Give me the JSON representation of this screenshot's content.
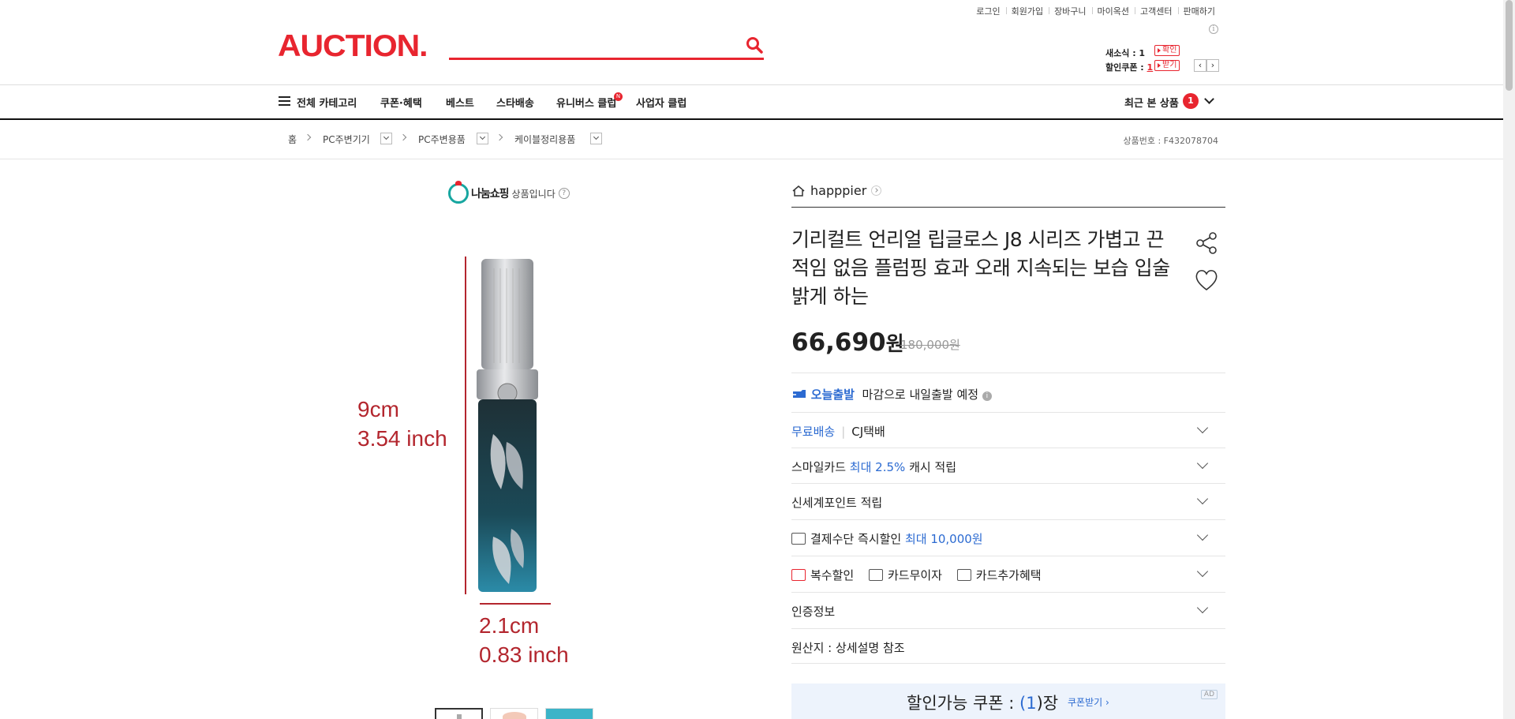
{
  "util_links": [
    "로그인",
    "회원가입",
    "장바구니",
    "마이옥션",
    "고객센터",
    "판매하기"
  ],
  "header": {
    "logo": "AUCTION.",
    "search_placeholder": "",
    "mini": {
      "newsletter_label": "새소식 : 1",
      "newsletter_btn": "확인",
      "coupon_label": "할인쿠폰 : ",
      "coupon_count": "1",
      "coupon_btn": "받기"
    }
  },
  "nav": {
    "all_categories": "전체 카테고리",
    "items": [
      "쿠폰·혜택",
      "베스트",
      "스타배송",
      "유니버스 클럽",
      "사업자 클럽"
    ],
    "new_badge": "N",
    "recent_label": "최근 본 상품",
    "recent_count": "1"
  },
  "breadcrumb": {
    "home": "홈",
    "levels": [
      "PC주변기기",
      "PC주변용품",
      "케이블정리용품"
    ],
    "product_no": "상품번호 : F432078704"
  },
  "share": {
    "brand": "나눔쇼핑",
    "text": "상품입니다",
    "help": "?"
  },
  "image": {
    "height_cm": "9cm",
    "height_inch": "3.54 inch",
    "width_cm": "2.1cm",
    "width_inch": "0.83 inch"
  },
  "product": {
    "seller": "happpier",
    "title": "기리컬트 언리얼 립글로스 J8 시리즈 가볍고 끈적임 없음 플럼핑 효과 오래 지속되는 보습 입술 밝게 하는",
    "price": "66,690",
    "price_unit": "원",
    "original_price": "180,000원"
  },
  "rows": {
    "today_ship": "오늘출발",
    "today_ship_desc": "마감으로 내일출발 예정",
    "free_ship": "무료배송",
    "courier": "CJ택배",
    "smile_card": "스마일카드",
    "smile_max": "최대 2.5%",
    "smile_tail": "캐시 적립",
    "shinsegae": "신세계포인트 적립",
    "pay_discount": "결제수단 즉시할인",
    "pay_max": "최대 10,000원",
    "multi_discount": "복수할인",
    "card_free": "카드무이자",
    "card_extra": "카드추가혜택",
    "cert": "인증정보",
    "origin": "원산지 : 상세설명 참조"
  },
  "coupon": {
    "label": "할인가능 쿠폰 : ",
    "open": "(",
    "count": "1",
    "close": ")장",
    "link": "쿠폰받기",
    "ad": "AD"
  },
  "colors": {
    "brand_red": "#e8252f",
    "link_blue": "#2b6ad1",
    "dim_red": "#b3262e"
  }
}
